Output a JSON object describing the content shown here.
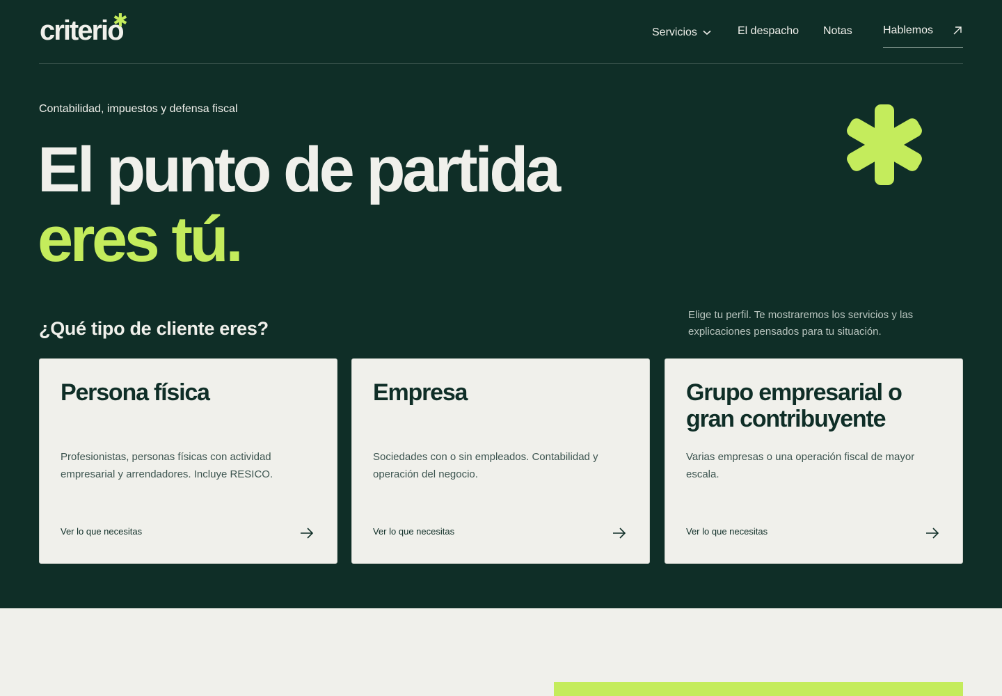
{
  "colors": {
    "hero_bg": "#0f2e27",
    "accent": "#c4ec5c",
    "light_bg": "#f0f0eb",
    "card_text": "#0f2e27"
  },
  "header": {
    "logo": "criterio",
    "nav": {
      "servicios": "Servicios",
      "despacho": "El despacho",
      "notas": "Notas",
      "hablemos": "Hablemos"
    }
  },
  "hero": {
    "eyebrow": "Contabilidad, impuestos y defensa fiscal",
    "headline_line1": "El punto de partida",
    "headline_line2": "eres tú."
  },
  "clients": {
    "question": "¿Qué tipo de cliente eres?",
    "hint": "Elige tu perfil. Te mostraremos los servicios y las explicaciones pensados para tu situación.",
    "cards": [
      {
        "title": "Persona física",
        "description": "Profesionistas, personas físicas con actividad empresarial y arrendadores. Incluye RESICO.",
        "link": "Ver lo que necesitas",
        "icon": "arrow-right-icon"
      },
      {
        "title": "Empresa",
        "description": "Sociedades con o sin empleados. Contabilidad y operación del negocio.",
        "link": "Ver lo que necesitas",
        "icon": "arrow-right-icon"
      },
      {
        "title": "Grupo empresarial o gran contribuyente",
        "description": "Varias empresas o una operación fiscal de mayor escala.",
        "link": "Ver lo que necesitas",
        "icon": "arrow-right-icon"
      }
    ]
  }
}
